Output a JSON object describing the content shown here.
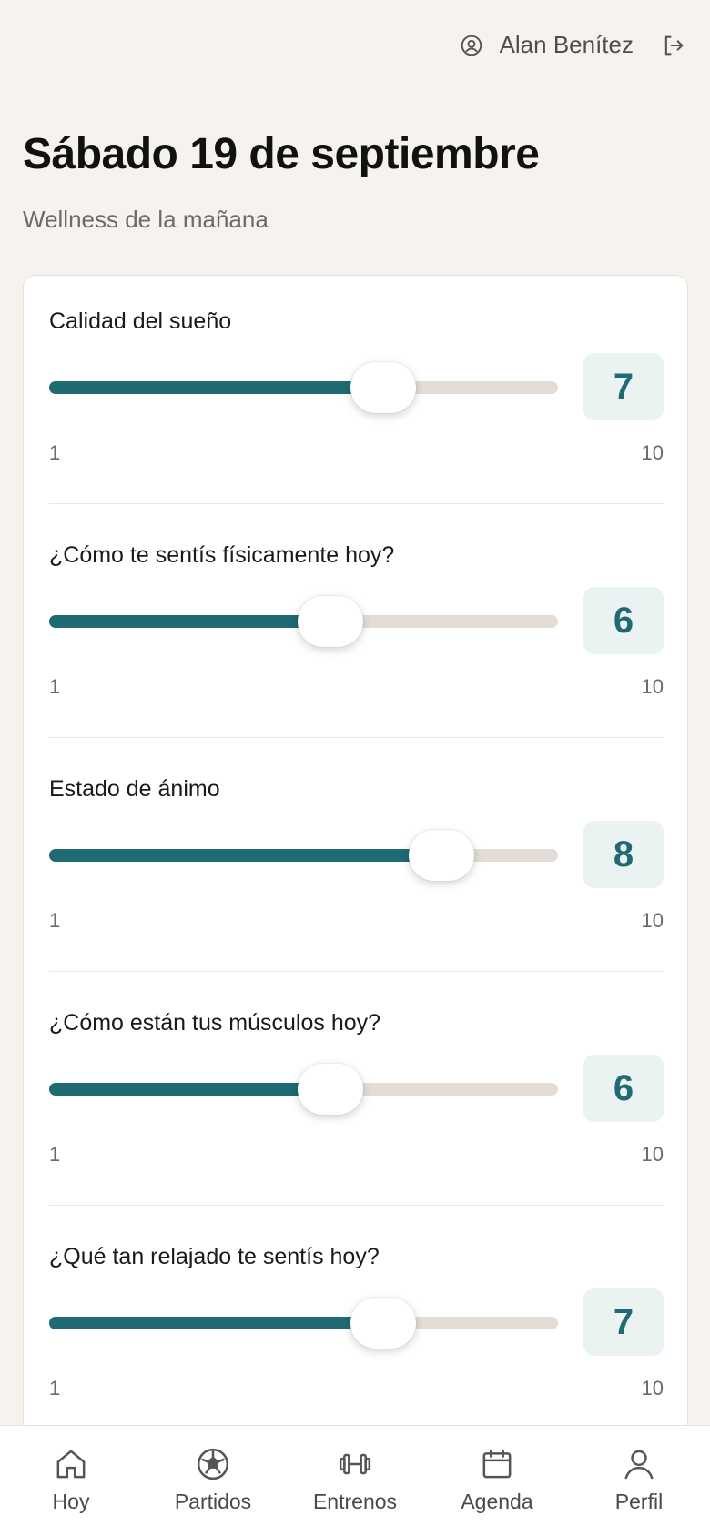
{
  "header": {
    "user_name": "Alan Benítez",
    "user_icon": "user-circle-icon",
    "logout_icon": "logout-icon"
  },
  "page": {
    "title": "Sábado 19 de septiembre",
    "subtitle": "Wellness de la mañana"
  },
  "questions": [
    {
      "label": "Calidad del sueño",
      "value": "7",
      "min": "1",
      "max": "10",
      "level": 7
    },
    {
      "label": "¿Cómo te sentís físicamente hoy?",
      "value": "6",
      "min": "1",
      "max": "10",
      "level": 6
    },
    {
      "label": "Estado de ánimo",
      "value": "8",
      "min": "1",
      "max": "10",
      "level": 8
    },
    {
      "label": "¿Cómo están tus músculos hoy?",
      "value": "6",
      "min": "1",
      "max": "10",
      "level": 6
    },
    {
      "label": "¿Qué tan relajado te sentís hoy?",
      "value": "7",
      "min": "1",
      "max": "10",
      "level": 7
    }
  ],
  "nav": [
    {
      "label": "Hoy",
      "icon": "home-icon"
    },
    {
      "label": "Partidos",
      "icon": "soccer-ball-icon"
    },
    {
      "label": "Entrenos",
      "icon": "dumbbell-icon"
    },
    {
      "label": "Agenda",
      "icon": "calendar-icon"
    },
    {
      "label": "Perfil",
      "icon": "user-icon"
    }
  ],
  "colors": {
    "accent": "#1f6a73",
    "track": "#e3ddd6",
    "value_bg": "#eaf2f2",
    "background": "#f6f3ef"
  }
}
